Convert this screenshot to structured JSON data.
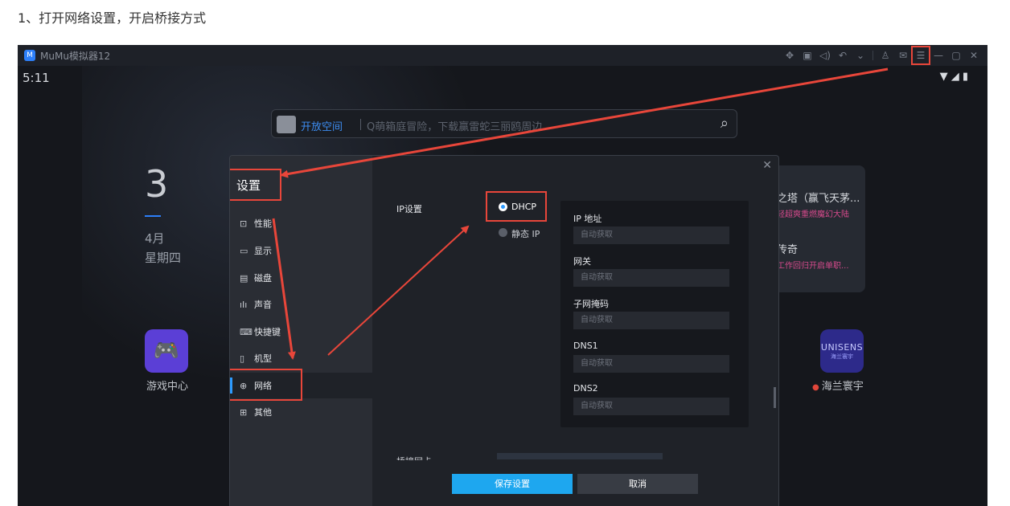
{
  "step_title": "1、打开网络设置，开启桥接方式",
  "window": {
    "app_title": "MuMu模拟器12",
    "clock": "5:11"
  },
  "search": {
    "space_label": "开放空间",
    "hint": "Q萌箱庭冒险，下载赢雷蛇三丽鸥周边"
  },
  "date": {
    "day": "3",
    "month": "4月",
    "weekday": "星期四"
  },
  "desktop": {
    "game_center_label": "游戏中心",
    "card_line1_title": "之塔（赢飞天茅...",
    "card_line1_sub": "轻超爽重燃魔幻大陆",
    "card_line2_title": "传奇",
    "card_line2_sub": "工作回归开启单职...",
    "unisens_logo": "UNISENS",
    "unisens_logo_sub": "海兰寰宇",
    "unisens_label": "海兰寰宇"
  },
  "settings": {
    "title": "设置",
    "menu": [
      {
        "icon": "performance-icon",
        "label": "性能"
      },
      {
        "icon": "display-icon",
        "label": "显示"
      },
      {
        "icon": "disk-icon",
        "label": "磁盘"
      },
      {
        "icon": "sound-icon",
        "label": "声音"
      },
      {
        "icon": "keyboard-icon",
        "label": "快捷键"
      },
      {
        "icon": "phone-icon",
        "label": "机型"
      },
      {
        "icon": "globe-icon",
        "label": "网络"
      },
      {
        "icon": "grid-icon",
        "label": "其他"
      }
    ],
    "active_menu": "网络",
    "ip_setting_label": "IP设置",
    "dhcp_label": "DHCP",
    "static_label": "静态 IP",
    "fields": [
      {
        "label": "IP 地址",
        "value": "自动获取"
      },
      {
        "label": "网关",
        "value": "自动获取"
      },
      {
        "label": "子网掩码",
        "value": "自动获取"
      },
      {
        "label": "DNS1",
        "value": "自动获取"
      },
      {
        "label": "DNS2",
        "value": "自动获取"
      }
    ],
    "bridge_label": "桥接网卡",
    "save_label": "保存设置",
    "cancel_label": "取消"
  },
  "colors": {
    "highlight_red": "#e8463a",
    "accent_blue": "#1ea7ef",
    "dark_bg": "#15171c"
  }
}
